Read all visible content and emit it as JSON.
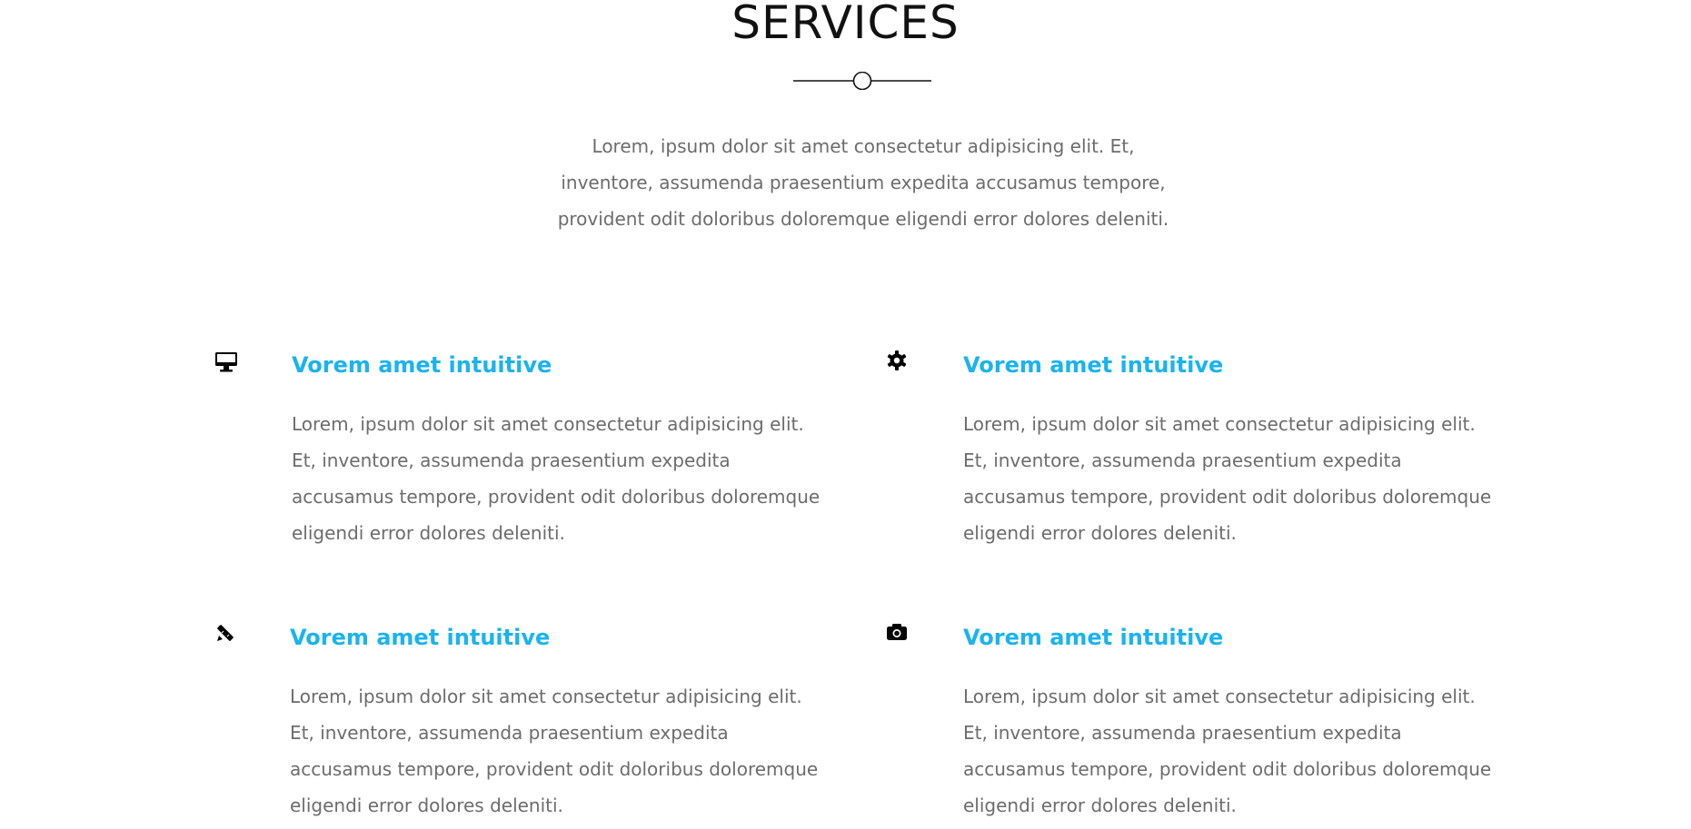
{
  "section": {
    "title": "SERVICES",
    "intro": "Lorem, ipsum dolor sit amet consectetur adipisicing elit. Et, inventore, assumenda praesentium expedita accusamus tempore, provident odit doloribus doloremque eligendi error dolores deleniti."
  },
  "colors": {
    "accent": "#1ab3ef",
    "text": "#6c6c6c",
    "heading": "#111111"
  },
  "services": [
    {
      "icon": "desktop-icon",
      "title": "Vorem amet intuitive",
      "text": "Lorem, ipsum dolor sit amet consectetur adipisicing elit. Et, inventore, assumenda praesentium expedita accusamus tempore, provident odit doloribus doloremque eligendi error dolores deleniti."
    },
    {
      "icon": "gear-icon",
      "title": "Vorem amet intuitive",
      "text": "Lorem, ipsum dolor sit amet consectetur adipisicing elit. Et, inventore, assumenda praesentium expedita accusamus tempore, provident odit doloribus doloremque eligendi error dolores deleniti."
    },
    {
      "icon": "pencil-ruler-icon",
      "title": "Vorem amet intuitive",
      "text": "Lorem, ipsum dolor sit amet consectetur adipisicing elit. Et, inventore, assumenda praesentium expedita accusamus tempore, provident odit doloribus doloremque eligendi error dolores deleniti."
    },
    {
      "icon": "camera-icon",
      "title": "Vorem amet intuitive",
      "text": "Lorem, ipsum dolor sit amet consectetur adipisicing elit. Et, inventore, assumenda praesentium expedita accusamus tempore, provident odit doloribus doloremque eligendi error dolores deleniti."
    }
  ]
}
